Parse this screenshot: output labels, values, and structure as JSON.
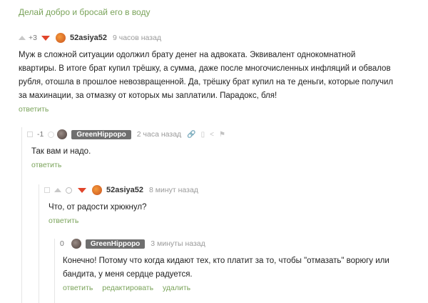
{
  "header": {
    "title": "Делай добро и бросай его в воду"
  },
  "comments": [
    {
      "rating": "+3",
      "username": "52asiya52",
      "time": "9 часов назад",
      "lines": [
        "Муж в сложной ситуации одолжил брату денег на адвоката. Эквивалент однокомнатной",
        "квартиры. В итоге брат купил трёшку, а сумма, даже после многочисленных инфляций и обвалов",
        "рубля, отошла в прошлое невозвращенной. Да, трёшку брат купил на те деньги, которые получил",
        "за махинации, за отмазку от которых мы заплатили. Парадокс, бля!"
      ],
      "actions": [
        "ответить"
      ]
    },
    {
      "rating": "-1",
      "username": "GreenHippopo",
      "time": "2 часа назад",
      "lines": [
        "Так вам и надо."
      ],
      "actions": [
        "ответить"
      ]
    },
    {
      "rating": "",
      "username": "52asiya52",
      "time": "8 минут назад",
      "lines": [
        "Что, от радости хрюкнул?"
      ],
      "actions": [
        "ответить"
      ]
    },
    {
      "rating": "0",
      "username": "GreenHippopo",
      "time": "3 минуты назад",
      "lines": [
        "Конечно! Потому что когда кидают тех, кто платит за то, чтобы \"отмазать\" ворюгу или",
        "бандита, у меня сердце радуется."
      ],
      "actions": [
        "ответить",
        "редактировать",
        "удалить"
      ]
    }
  ],
  "icons": {
    "up": "arrow-up-icon",
    "down": "arrow-down-icon",
    "bookmark": "bookmark-icon",
    "share": "share-icon",
    "flag": "flag-icon"
  },
  "colors": {
    "link": "#7aa35a",
    "down": "#e1452b",
    "pill": "#6f6f6f"
  }
}
